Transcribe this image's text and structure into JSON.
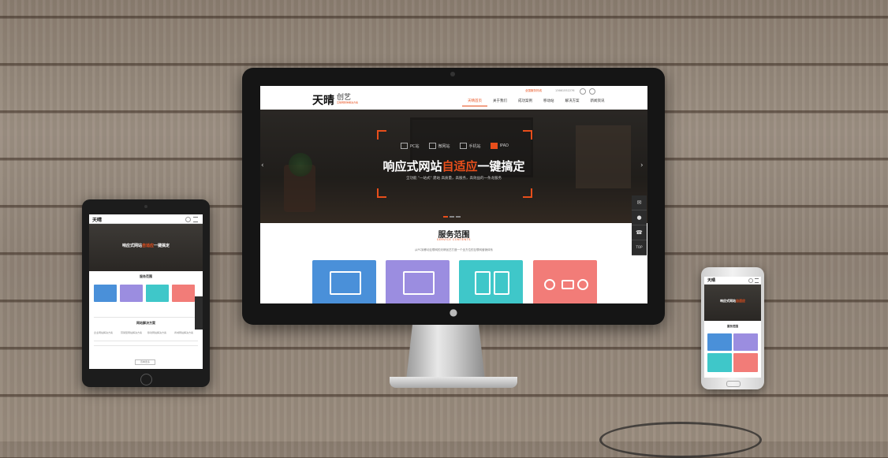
{
  "desktop_site": {
    "logo": {
      "main": "天晴",
      "script": "创艺",
      "tagline": "互联网整体解决方案"
    },
    "top_contact": {
      "phone": "全国服务热线",
      "number": "13661552276"
    },
    "nav": [
      "天晴首页",
      "关于我们",
      "成功案例",
      "移动站",
      "解决方案",
      "新闻资讯"
    ],
    "hero": {
      "devices": [
        "PC站",
        "微网站",
        "手机站",
        "IPAD"
      ],
      "headline_pre": "响应式网站",
      "headline_highlight": "自适应",
      "headline_post": "一键搞定",
      "subline": "全功能 \"一站式\" 建站 高质量，高服务，高效益的一条龙服务"
    },
    "services": {
      "title": "服务范围",
      "subtitle_en": "SERVICE CONTENTS",
      "description": "从PC到移动互联网的天晴创艺打造一个全方位的互联网营销体系"
    },
    "sidebar": {
      "top_label": "TOP"
    }
  },
  "tablet_site": {
    "logo": "天晴",
    "headline_pre": "响应式网站",
    "headline_highlight": "自适应",
    "headline_post": "一键搞定",
    "services_title": "服务范围",
    "solutions_title": "网站解决方案",
    "cols": [
      "企业网站解决方案",
      "营销型网站解决方案",
      "移动网站解决方案",
      "商城网站解决方案"
    ],
    "more": "查看更多"
  },
  "phone_site": {
    "logo": "天晴",
    "headline_pre": "响应式网站",
    "headline_highlight": "自适应",
    "services_title": "服务范围"
  },
  "colors": {
    "accent": "#e84e1b",
    "blue": "#4a90d9",
    "purple": "#9b8de0",
    "teal": "#3fc7c9",
    "coral": "#f27c78"
  }
}
